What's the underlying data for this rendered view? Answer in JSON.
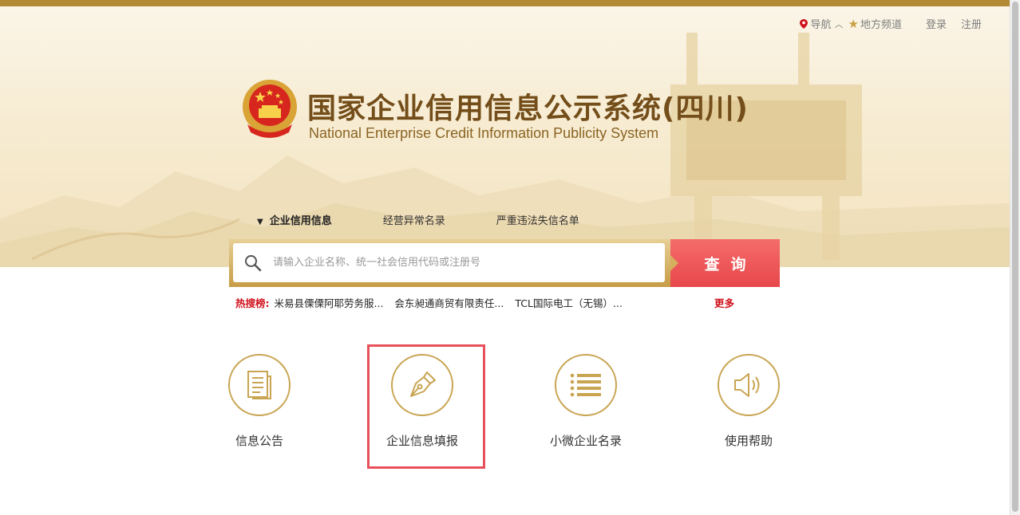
{
  "nav": {
    "daohang": "导航",
    "local_channel": "地方频道",
    "login": "登录",
    "register": "注册"
  },
  "header": {
    "title_cn": "国家企业信用信息公示系统",
    "title_region": "(四川)",
    "title_en": "National Enterprise Credit Information Publicity System"
  },
  "search": {
    "tabs": [
      "企业信用信息",
      "经营异常名录",
      "严重违法失信名单"
    ],
    "placeholder": "请输入企业名称、统一社会信用代码或注册号",
    "button": "查询"
  },
  "hot": {
    "label": "热搜榜:",
    "keywords": [
      "米易县傈傈阿耶劳务服...",
      "会东昶通商贸有限责任...",
      "TCL国际电工（无锡）..."
    ],
    "more": "更多"
  },
  "features": [
    {
      "label": "信息公告",
      "icon": "document-icon"
    },
    {
      "label": "企业信息填报",
      "icon": "pen-icon"
    },
    {
      "label": "小微企业名录",
      "icon": "list-icon"
    },
    {
      "label": "使用帮助",
      "icon": "speaker-icon"
    }
  ],
  "colors": {
    "brand_gold": "#b38a34",
    "title_brown": "#744e1a",
    "search_red": "#e8474a",
    "hot_red": "#d0121b",
    "highlight_red": "#e8505b"
  }
}
